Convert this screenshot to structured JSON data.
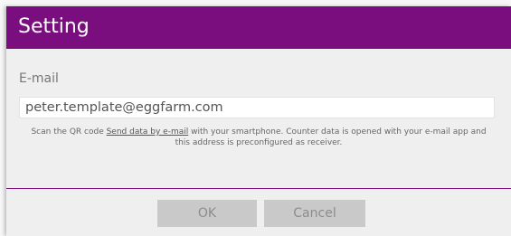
{
  "dialog": {
    "title": "Setting",
    "email_label": "E-mail",
    "email_value": "peter.template@eggfarm.com",
    "hint_before": "Scan the QR code ",
    "hint_link": "Send data by e-mail",
    "hint_after": " with your smartphone. Counter data is opened with your e-mail app and this address is preconfigured as receiver.",
    "ok_label": "OK",
    "cancel_label": "Cancel"
  },
  "colors": {
    "title_bar": "#7a0e7e",
    "dialog_bg": "#efefef",
    "button_bg": "#c9c9c9"
  }
}
